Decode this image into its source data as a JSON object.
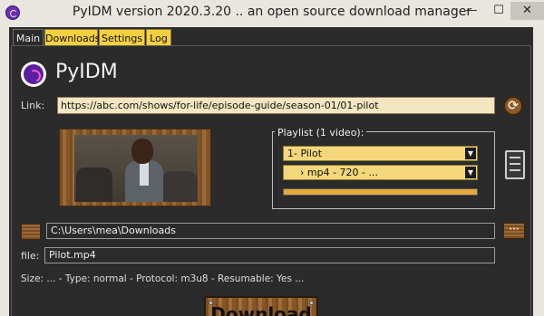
{
  "window": {
    "title": "PyIDM version 2020.3.20 .. an open source download manager",
    "minimize_label": "—",
    "maximize_label": "☐",
    "close_label": "✕"
  },
  "tabs": [
    {
      "label": "Main",
      "active": true
    },
    {
      "label": "Downloads",
      "active": false
    },
    {
      "label": "Settings",
      "active": false
    },
    {
      "label": "Log",
      "active": false
    }
  ],
  "main": {
    "app_name": "PyIDM",
    "link_label": "Link:",
    "link_value": "https://abc.com/shows/for-life/episode-guide/season-01/01-pilot",
    "playlist": {
      "title": "Playlist (1 video):",
      "selected_video": "1- Pilot",
      "selected_stream": "› mp4 - 720 - ...",
      "progress_fraction": 1.0
    },
    "folder_value": "C:\\Users\\mea\\Downloads",
    "browse_label": "···",
    "file_label": "file:",
    "file_value": "Pilot.mp4",
    "info_text": "Size: ... - Type: normal  - Protocol: m3u8 - Resumable: Yes ...",
    "download_label": "Download",
    "refresh_icon": "⟳",
    "dropdown_arrow": "▼"
  },
  "colors": {
    "background": "#2b2b2b",
    "tab_inactive": "#f4d03f",
    "link_field": "#f3e6c0",
    "select_field": "#f3d77a",
    "progress": "#e3a93d",
    "wood": "#8a5a2b"
  }
}
